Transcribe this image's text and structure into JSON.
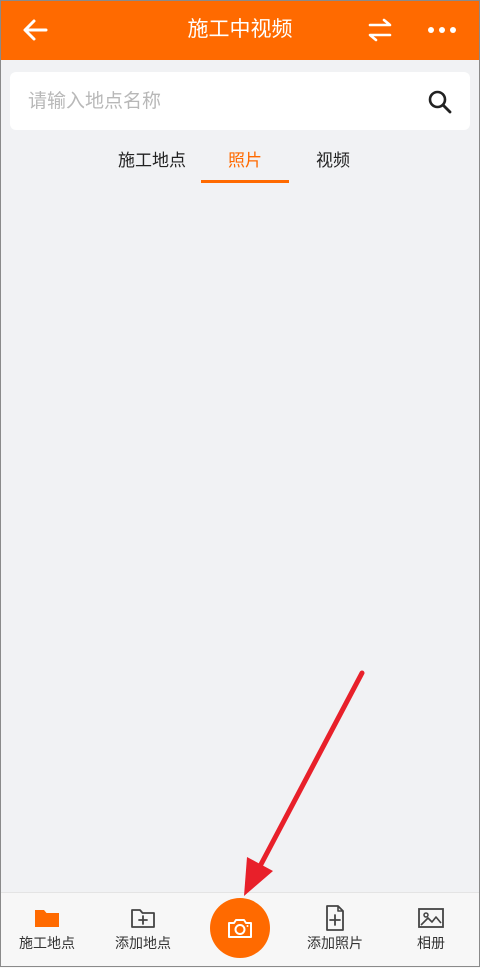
{
  "header": {
    "title": "施工中视频",
    "back_icon": "arrow-left-icon",
    "swap_icon": "swap-arrows-icon",
    "more_icon": "more-dots-icon"
  },
  "search": {
    "placeholder": "请输入地点名称",
    "value": "",
    "icon": "search-icon"
  },
  "tabs": [
    {
      "label": "施工地点",
      "active": false
    },
    {
      "label": "照片",
      "active": true
    },
    {
      "label": "视频",
      "active": false
    }
  ],
  "bottom_nav": {
    "items": [
      {
        "label": "施工地点",
        "icon": "folder-icon"
      },
      {
        "label": "添加地点",
        "icon": "folder-add-icon"
      },
      {
        "label": "添加照片",
        "icon": "file-add-icon"
      },
      {
        "label": "相册",
        "icon": "image-icon"
      }
    ],
    "camera_icon": "camera-icon"
  },
  "colors": {
    "accent": "#ff6a00",
    "background": "#f1f2f4",
    "annotation_arrow": "#e8202a"
  }
}
